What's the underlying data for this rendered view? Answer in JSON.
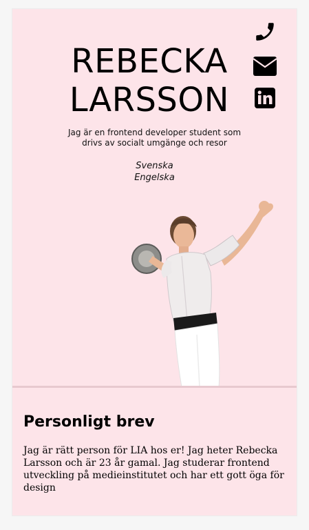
{
  "profile": {
    "first_name": "REBECKA",
    "last_name": "LARSSON",
    "tagline": "Jag är en frontend developer student som drivs av socialt umgänge och resor",
    "languages": [
      "Svenska",
      "Engelska"
    ]
  },
  "contact": {
    "icons": [
      "phone-icon",
      "envelope-icon",
      "linkedin-icon"
    ]
  },
  "letter": {
    "heading": "Personligt brev",
    "body": "Jag är rätt person för LIA hos er! Jag heter Rebecka Larsson och är 23 år gamal. Jag studerar frontend utveckling på medieinstitutet och har ett gott öga för design"
  },
  "colors": {
    "card_background": "#fde4e9",
    "page_background": "#f6f6f6",
    "divider": "#e7c9cf"
  }
}
